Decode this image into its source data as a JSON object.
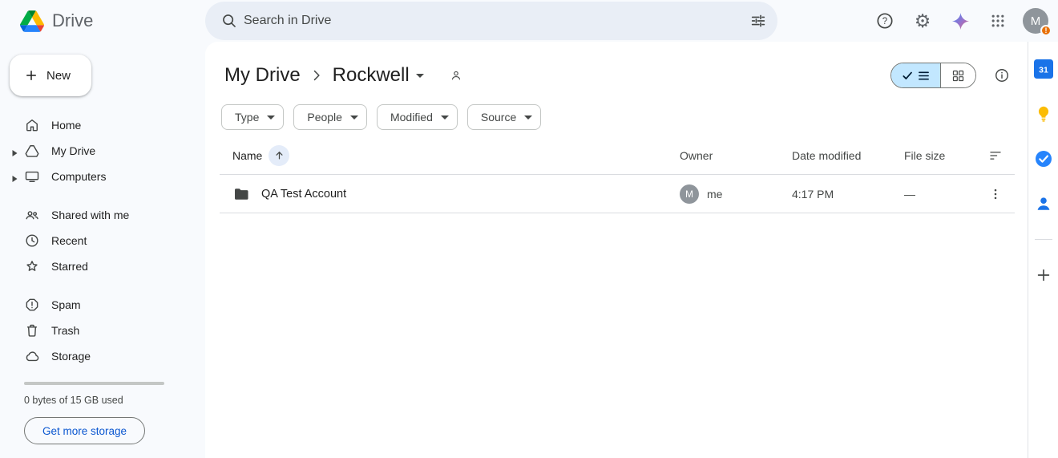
{
  "topbar": {
    "app_name": "Drive",
    "search": {
      "placeholder": "Search in Drive"
    },
    "avatar_letter": "M",
    "badge": "!"
  },
  "sidebar": {
    "new_label": "New",
    "groups": [
      {
        "items": [
          {
            "label": "Home"
          },
          {
            "label": "My Drive"
          },
          {
            "label": "Computers"
          }
        ]
      },
      {
        "items": [
          {
            "label": "Shared with me"
          },
          {
            "label": "Recent"
          },
          {
            "label": "Starred"
          }
        ]
      },
      {
        "items": [
          {
            "label": "Spam"
          },
          {
            "label": "Trash"
          },
          {
            "label": "Storage"
          }
        ]
      }
    ],
    "storage_text": "0 bytes of 15 GB used",
    "get_more_label": "Get more storage"
  },
  "main": {
    "breadcrumb": {
      "root": "My Drive",
      "current": "Rockwell"
    },
    "filters": [
      {
        "label": "Type"
      },
      {
        "label": "People"
      },
      {
        "label": "Modified"
      },
      {
        "label": "Source"
      }
    ],
    "table": {
      "columns": {
        "name": "Name",
        "owner": "Owner",
        "modified": "Date modified",
        "size": "File size"
      },
      "rows": [
        {
          "name": "QA Test Account",
          "owner": "me",
          "owner_avatar": "M",
          "modified": "4:17 PM",
          "size": "—"
        }
      ]
    }
  },
  "side_panel": {
    "calendar_label": "31"
  },
  "colors": {
    "accent_blue": "#0b57d0",
    "selected_toggle": "#c2e7ff",
    "page_bg": "#f8fafd",
    "search_bg": "#e9eef6",
    "folder_icon": "#444746"
  }
}
